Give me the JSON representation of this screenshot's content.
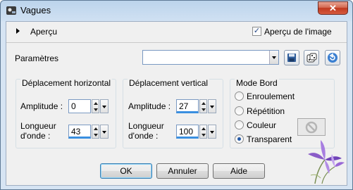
{
  "window": {
    "title": "Vagues",
    "close_glyph": "✕"
  },
  "preview": {
    "label": "Aperçu",
    "image_preview_label": "Aperçu de l'image",
    "image_preview_checked": true,
    "check_glyph": "✓"
  },
  "params": {
    "label": "Paramètres",
    "preset_value": ""
  },
  "horizontal": {
    "title": "Déplacement horizontal",
    "amplitude_label": "Amplitude :",
    "amplitude_value": "0",
    "wavelength_label_line1": "Longueur",
    "wavelength_label_line2": "d'onde :",
    "wavelength_value": "43"
  },
  "vertical": {
    "title": "Déplacement vertical",
    "amplitude_label": "Amplitude :",
    "amplitude_value": "27",
    "wavelength_label_line1": "Longueur",
    "wavelength_label_line2": "d'onde :",
    "wavelength_value": "100"
  },
  "edge_mode": {
    "title": "Mode Bord",
    "options": [
      "Enroulement",
      "Répétition",
      "Couleur",
      "Transparent"
    ],
    "selected": "Transparent"
  },
  "buttons": {
    "ok": "OK",
    "cancel": "Annuler",
    "help": "Aide"
  },
  "icons": [
    "app-icon",
    "save-icon",
    "dice-icon",
    "reset-icon",
    "no-color-icon",
    "flower-watermark"
  ],
  "colors": {
    "accent": "#3a8fe0",
    "close_red": "#c0391f",
    "frame": "#bcd4ec"
  }
}
